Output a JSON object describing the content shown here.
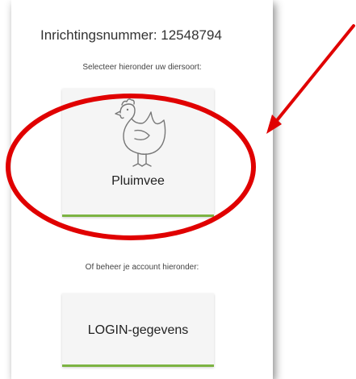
{
  "header": {
    "facility_label": "Inrichtingsnummer: 12548794"
  },
  "species_section": {
    "prompt": "Selecteer hieronder uw diersoort:",
    "card": {
      "label": "Pluimvee",
      "icon": "chicken-icon",
      "accent": "#7cb342"
    }
  },
  "account_section": {
    "prompt": "Of beheer je account hieronder:",
    "card": {
      "label": "LOGIN-gegevens",
      "accent": "#7cb342"
    }
  },
  "annotation": {
    "color": "#e00000"
  }
}
